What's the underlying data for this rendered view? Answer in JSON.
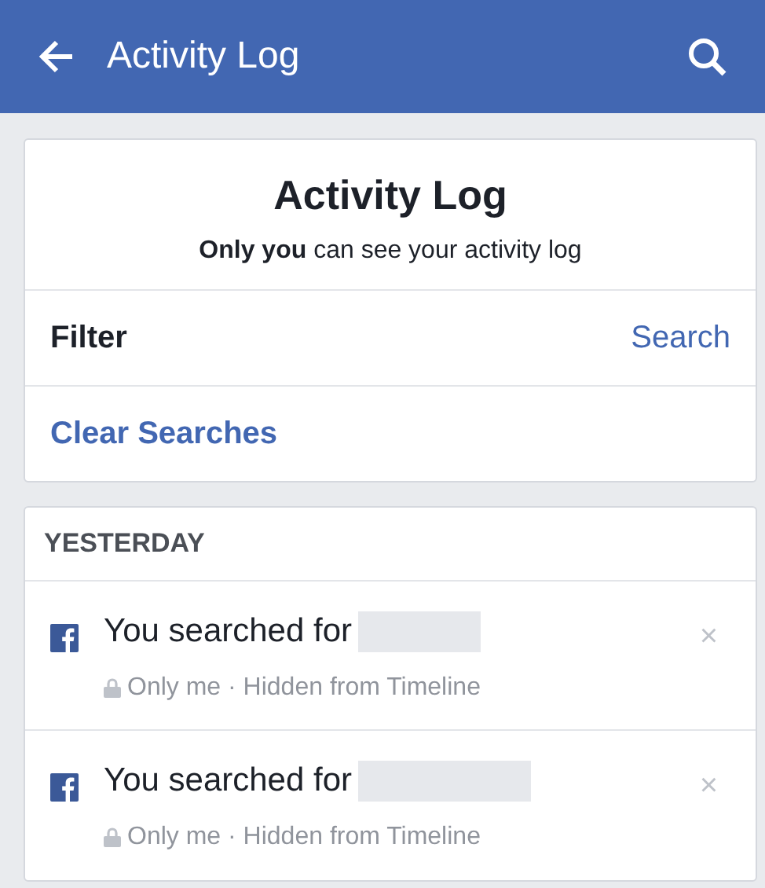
{
  "top_bar": {
    "title": "Activity Log"
  },
  "header_card": {
    "title": "Activity Log",
    "subtitle": "**Only you** can see your activity log",
    "filter_label": "Filter",
    "search_link": "Search",
    "clear_link": "Clear Searches"
  },
  "log_section": {
    "heading": "YESTERDAY",
    "items": [
      {
        "text": "You searched for",
        "privacy": "Only me · Hidden from Timeline",
        "close": "×"
      },
      {
        "text": "You searched for",
        "privacy": "Only me · Hidden from Timeline",
        "close": "×"
      }
    ]
  }
}
